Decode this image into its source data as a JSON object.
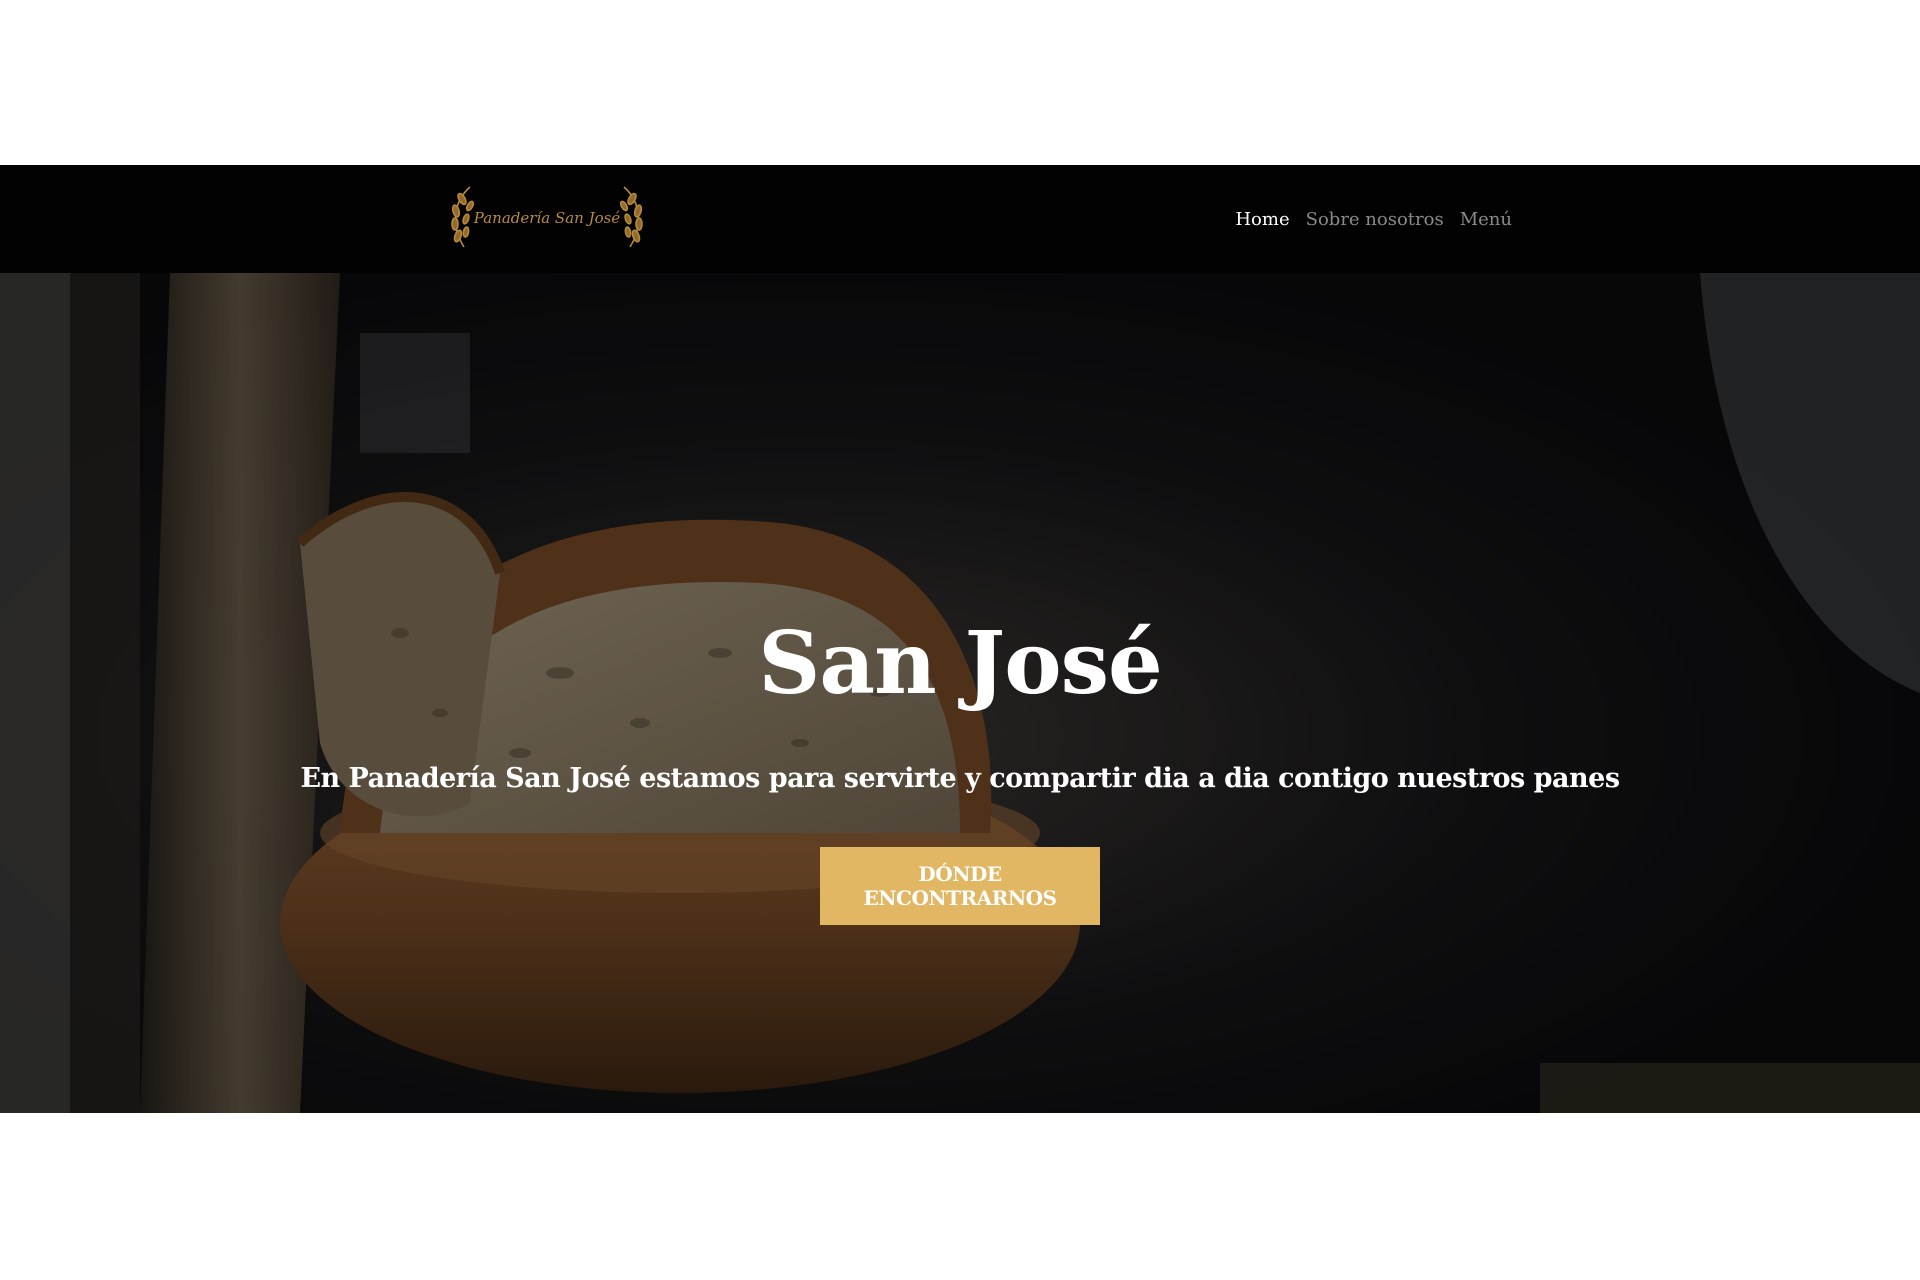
{
  "navbar": {
    "logo_text": "Panadería San José",
    "links": [
      {
        "label": "Home",
        "active": true
      },
      {
        "label": "Sobre nosotros",
        "active": false
      },
      {
        "label": "Menú",
        "active": false
      }
    ]
  },
  "hero": {
    "title": "San José",
    "subtitle": "En Panadería San José estamos para servirte y compartir dia a dia contigo nuestros panes",
    "button_label": "DÓNDE ENCONTRARNOS"
  },
  "colors": {
    "navbar_bg": "#020202",
    "accent": "#e1b764",
    "logo_gold": "#b88a3c",
    "nav_inactive": "#8a8a8a",
    "nav_active": "#ffffff"
  },
  "icons": {
    "logo_laurel_left": "wheat-laurel-icon",
    "logo_laurel_right": "wheat-laurel-icon"
  }
}
